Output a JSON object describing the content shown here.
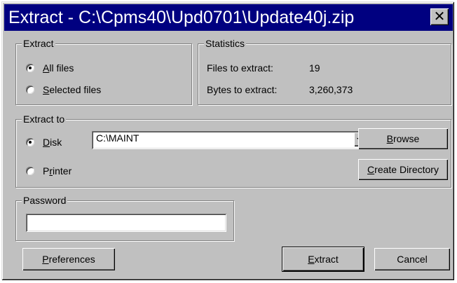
{
  "window": {
    "title": "Extract - C:\\Cpms40\\Upd0701\\Update40j.zip",
    "close_glyph": "✕"
  },
  "extract_group": {
    "legend": "Extract",
    "all_files": {
      "accel": "A",
      "rest": "ll files",
      "checked": true
    },
    "selected_files": {
      "accel": "S",
      "rest": "elected files",
      "checked": false
    }
  },
  "statistics_group": {
    "legend": "Statistics",
    "files_label": "Files to extract:",
    "files_value": "19",
    "bytes_label": "Bytes to extract:",
    "bytes_value": "3,260,373"
  },
  "extract_to_group": {
    "legend": "Extract to",
    "disk": {
      "accel": "D",
      "rest": "isk",
      "checked": true
    },
    "printer": {
      "pre": "P",
      "accel": "r",
      "rest": "inter",
      "checked": false
    },
    "path_value": "C:\\MAINT",
    "browse": {
      "accel": "B",
      "rest": "rowse"
    },
    "create_directory": {
      "accel": "C",
      "rest": "reate Directory"
    }
  },
  "password_group": {
    "legend": "Password",
    "value": ""
  },
  "buttons": {
    "preferences": {
      "accel": "P",
      "rest": "references"
    },
    "extract": {
      "accel": "E",
      "rest": "xtract"
    },
    "cancel": "Cancel"
  }
}
